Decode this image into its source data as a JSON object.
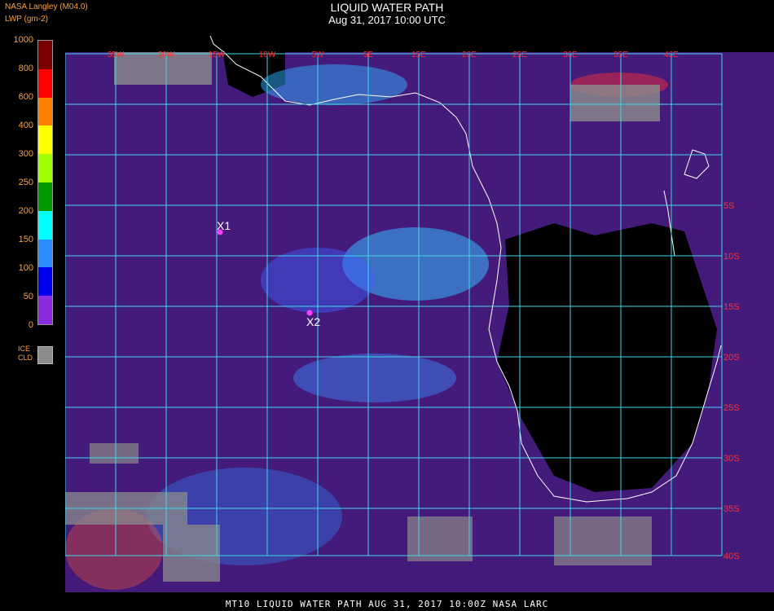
{
  "header": {
    "title": "LIQUID WATER PATH",
    "subtitle": "Aug 31, 2017 10:00 UTC",
    "source": "NASA Langley (M04.0)",
    "units": "LWP (gm-2)"
  },
  "legend": {
    "ticks": [
      "1000",
      "800",
      "600",
      "400",
      "300",
      "250",
      "200",
      "150",
      "100",
      "50",
      "0"
    ],
    "colors": [
      "#7a0000",
      "#ff0000",
      "#ff7f00",
      "#ffff00",
      "#a0ff00",
      "#009900",
      "#00ffff",
      "#2a8cff",
      "#0000ee",
      "#8a2be2"
    ],
    "ice_label_1": "ICE",
    "ice_label_2": "CLD",
    "ice_color": "#8c8c8c"
  },
  "map": {
    "lon_labels": [
      "35W",
      "30W",
      "15W",
      "10W",
      "5W",
      "5E",
      "15E",
      "20E",
      "25E",
      "30E",
      "35E",
      "40E"
    ],
    "lat_labels": [
      "5S",
      "10S",
      "15S",
      "20S",
      "25S",
      "30S",
      "35S",
      "40S"
    ],
    "markers": [
      {
        "label": "X1",
        "color": "#ff3cff"
      },
      {
        "label": "X2",
        "color": "#ff3cff"
      }
    ],
    "grid_color": "#40d8e8",
    "coast_color": "#ffffff"
  },
  "footer": {
    "text": "MT10  LIQUID WATER PATH   AUG 31, 2017 10:00Z   NASA LARC"
  }
}
